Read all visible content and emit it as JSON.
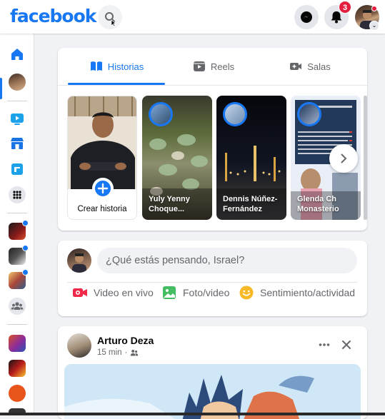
{
  "header": {
    "logo": "facebook",
    "notifications_count": "3"
  },
  "colors": {
    "brand_blue": "#1877f2",
    "notification_red": "#e41e3f",
    "live_video_red": "#f02849",
    "photo_green": "#45bd62",
    "feeling_yellow": "#f7b928"
  },
  "left_rail": {
    "items": [
      "home-icon",
      "profile-avatar",
      "watch-icon",
      "marketplace-icon",
      "gaming-icon",
      "menu-grid-icon",
      "shortcut-1",
      "shortcut-2",
      "shortcut-3",
      "groups-icon",
      "shortcut-4",
      "shortcut-5",
      "shortcut-6"
    ]
  },
  "stories_card": {
    "tabs": [
      {
        "label": "Historias",
        "icon": "book-icon",
        "active": true
      },
      {
        "label": "Reels",
        "icon": "reels-icon",
        "active": false
      },
      {
        "label": "Salas",
        "icon": "video-camera-icon",
        "active": false
      }
    ],
    "create_story_label": "Crear historia",
    "stories": [
      {
        "name": "Yuly Yenny Choque..."
      },
      {
        "name": "Dennis Núñez-Fernández"
      },
      {
        "name": "Glenda Ch Monasterio"
      }
    ]
  },
  "composer": {
    "placeholder": "¿Qué estás pensando, Israel?",
    "actions": [
      {
        "label": "Video en vivo",
        "icon": "live-video-icon"
      },
      {
        "label": "Foto/video",
        "icon": "photo-icon"
      },
      {
        "label": "Sentimiento/actividad",
        "icon": "smiley-icon"
      }
    ]
  },
  "post": {
    "author": "Arturo Deza",
    "time": "15 min",
    "audience_icon": "friends-icon"
  }
}
